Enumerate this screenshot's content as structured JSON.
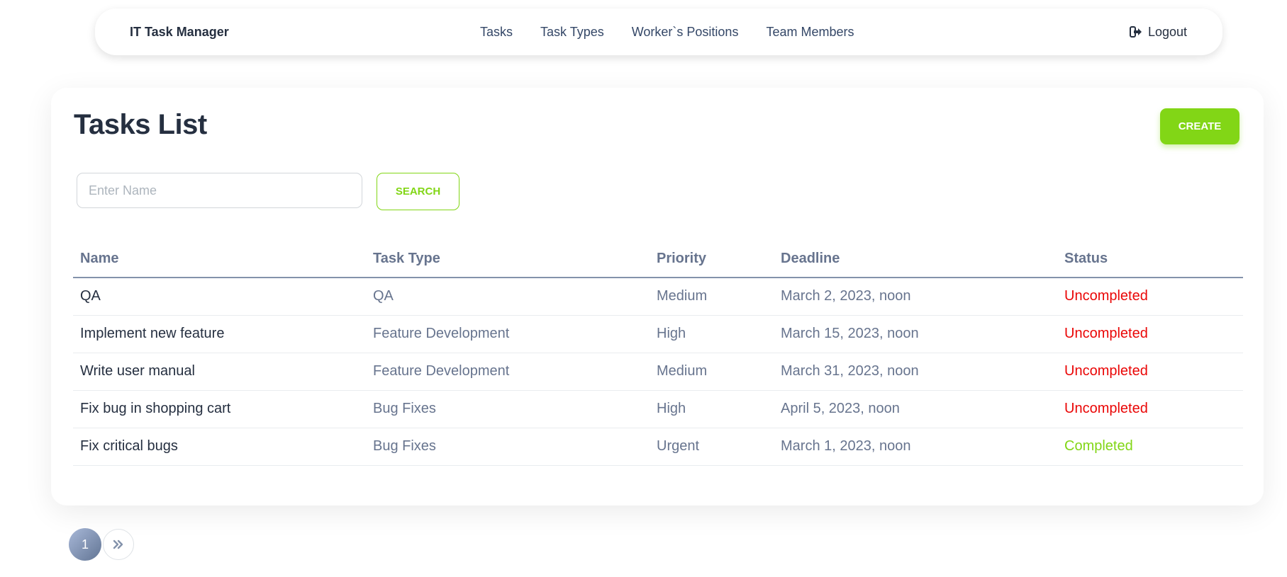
{
  "navbar": {
    "brand": "IT Task Manager",
    "links": [
      "Tasks",
      "Task Types",
      "Worker`s Positions",
      "Team Members"
    ],
    "logout_label": "Logout"
  },
  "main": {
    "title": "Tasks List",
    "create_label": "CREATE",
    "search": {
      "placeholder": "Enter Name",
      "value": "",
      "button_label": "SEARCH"
    }
  },
  "table": {
    "columns": [
      "Name",
      "Task Type",
      "Priority",
      "Deadline",
      "Status"
    ],
    "rows": [
      {
        "name": "QA",
        "task_type": "QA",
        "priority": "Medium",
        "deadline": "March 2, 2023, noon",
        "status": "Uncompleted"
      },
      {
        "name": "Implement new feature",
        "task_type": "Feature Development",
        "priority": "High",
        "deadline": "March 15, 2023, noon",
        "status": "Uncompleted"
      },
      {
        "name": "Write user manual",
        "task_type": "Feature Development",
        "priority": "Medium",
        "deadline": "March 31, 2023, noon",
        "status": "Uncompleted"
      },
      {
        "name": "Fix bug in shopping cart",
        "task_type": "Bug Fixes",
        "priority": "High",
        "deadline": "April 5, 2023, noon",
        "status": "Uncompleted"
      },
      {
        "name": "Fix critical bugs",
        "task_type": "Bug Fixes",
        "priority": "Urgent",
        "deadline": "March 1, 2023, noon",
        "status": "Completed"
      }
    ]
  },
  "pagination": {
    "current_page": "1",
    "next_icon": "double-chevron-right-icon"
  },
  "colors": {
    "accent": "#82d616",
    "uncompleted": "#ea0606",
    "completed": "#82d616",
    "heading": "#252f40",
    "muted": "#67748e"
  }
}
